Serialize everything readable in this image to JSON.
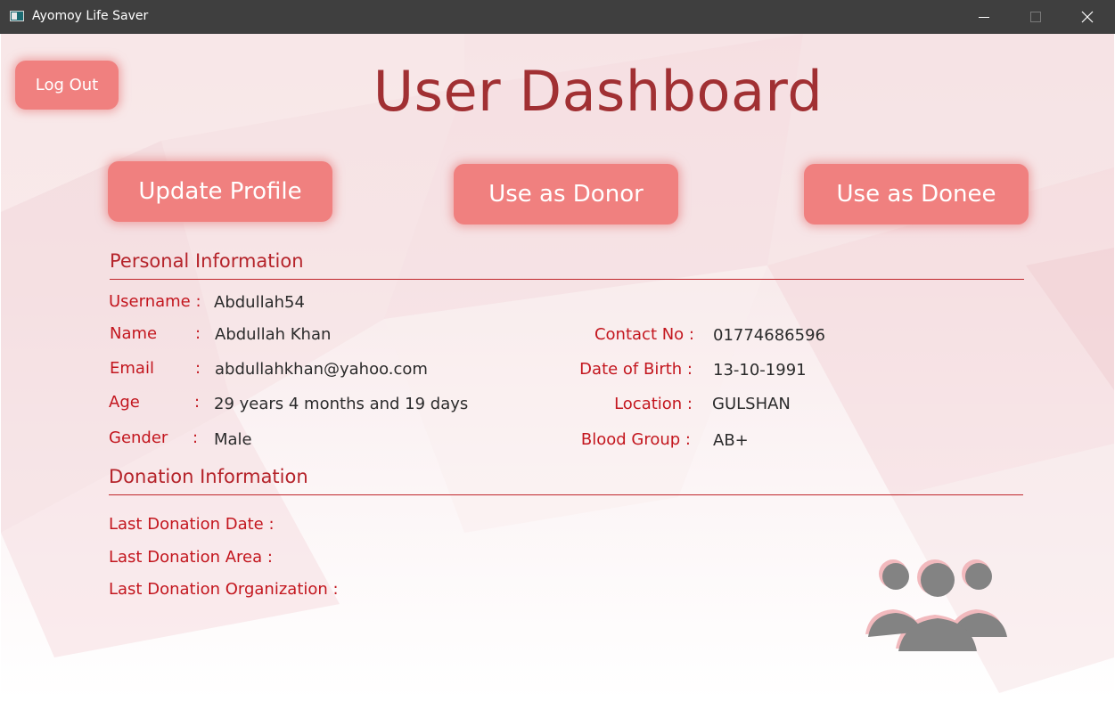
{
  "window": {
    "title": "Ayomoy Life Saver",
    "controls": {
      "minimize": "—",
      "maximize": "☐",
      "close": "✕"
    }
  },
  "header": {
    "logout_label": "Log Out",
    "title": "User Dashboard"
  },
  "actions": {
    "update_profile": "Update Profile",
    "use_as_donor": "Use as Donor",
    "use_as_donee": "Use as Donee"
  },
  "personal": {
    "section_title": "Personal Information",
    "username": {
      "label": "Username :",
      "value": "Abdullah54"
    },
    "name": {
      "label": "Name",
      "colon": ":",
      "value": "Abdullah Khan"
    },
    "email": {
      "label": "Email",
      "colon": ":",
      "value": "abdullahkhan@yahoo.com"
    },
    "age": {
      "label": "Age",
      "colon": ":",
      "value": "29 years 4 months and 19 days"
    },
    "gender": {
      "label": "Gender",
      "colon": ":",
      "value": "Male"
    },
    "contact": {
      "label": "Contact No :",
      "value": "01774686596"
    },
    "dob": {
      "label": "Date of Birth :",
      "value": "13-10-1991"
    },
    "location": {
      "label": "Location :",
      "value": "GULSHAN"
    },
    "blood_group": {
      "label": "Blood Group :",
      "value": "AB+"
    }
  },
  "donation": {
    "section_title": "Donation Information",
    "last_date": {
      "label": "Last Donation Date :",
      "value": ""
    },
    "last_area": {
      "label": "Last Donation Area :",
      "value": ""
    },
    "last_org": {
      "label": "Last Donation Organization :",
      "value": ""
    }
  },
  "icons": {
    "app": "app-icon",
    "people": "users-group-icon"
  },
  "colors": {
    "titlebar": "#3f3f3f",
    "button": "#f0807f",
    "heading": "#a13033",
    "label": "#c3161e",
    "rule": "#c0262b",
    "value": "#2b2b2b"
  }
}
